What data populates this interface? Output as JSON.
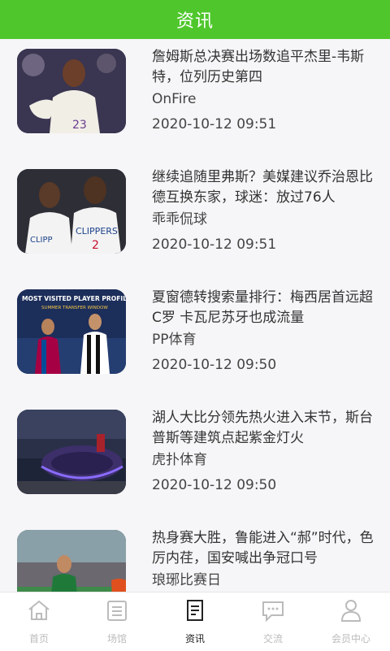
{
  "header": {
    "title": "资讯"
  },
  "news": [
    {
      "title": "詹姆斯总决赛出场数追平杰里-韦斯特，位列历史第四",
      "source": "OnFire",
      "time": "2020-10-12 09:51",
      "image_icon": "basketball-player-photo"
    },
    {
      "title": "继续追随里弗斯？美媒建议乔治恩比德互换东家，球迷：放过76人",
      "source": "乖乖侃球",
      "time": "2020-10-12 09:51",
      "image_icon": "clippers-players-photo"
    },
    {
      "title": "夏窗德转搜索量排行：梅西居首远超C罗 卡瓦尼苏牙也成流量",
      "source": "PP体育",
      "time": "2020-10-12 09:50",
      "image_icon": "transfer-window-graphic",
      "image_text_1": "MOST VISITED PLAYER PROFILES",
      "image_text_2": "SUMMER TRANSFER WINDOW"
    },
    {
      "title": "湖人大比分领先热火进入末节，斯台普斯等建筑点起紫金灯火",
      "source": "虎扑体育",
      "time": "2020-10-12 09:50",
      "image_icon": "arena-night-photo"
    },
    {
      "title": "热身赛大胜，鲁能进入“郝”时代，色厉内荏，国安喊出争冠口号",
      "source": "琅琊比赛日",
      "time": "",
      "image_icon": "soccer-player-photo"
    }
  ],
  "tabbar": [
    {
      "label": "首页",
      "icon": "home-icon",
      "active": false
    },
    {
      "label": "场馆",
      "icon": "venue-icon",
      "active": false
    },
    {
      "label": "资讯",
      "icon": "news-icon",
      "active": true
    },
    {
      "label": "交流",
      "icon": "chat-icon",
      "active": false
    },
    {
      "label": "会员中心",
      "icon": "user-icon",
      "active": false
    }
  ],
  "colors": {
    "accent": "#4fc72c",
    "tab_inactive": "#bbbbbb",
    "tab_active": "#222222"
  }
}
